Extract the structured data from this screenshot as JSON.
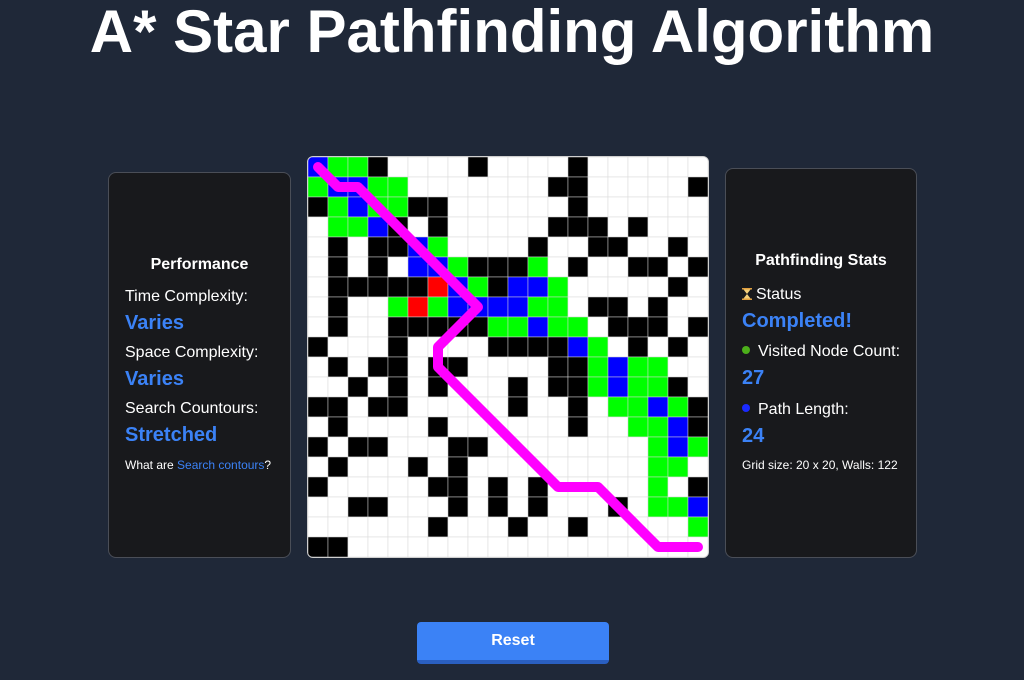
{
  "title": "A* Star Pathfinding Algorithm",
  "performance": {
    "heading": "Performance",
    "time_label": "Time Complexity:",
    "time_value": "Varies",
    "space_label": "Space Complexity:",
    "space_value": "Varies",
    "contour_label": "Search Countours:",
    "contour_value": "Stretched",
    "question_prefix": "What are ",
    "question_link": "Search contours",
    "question_suffix": "?"
  },
  "stats": {
    "heading": "Pathfinding Stats",
    "status_icon": "hourglass-icon",
    "status_label": "Status",
    "status_value": "Completed!",
    "visited_label": "Visited Node Count:",
    "visited_value": "27",
    "path_label": "Path Length:",
    "path_value": "24",
    "grid_info": "Grid size: 20 x 20, Walls: 122"
  },
  "reset_label": "Reset",
  "colors": {
    "wall": "#000000",
    "empty": "#ffffff",
    "visited": "#00ff00",
    "path_cell": "#0000ff",
    "frontier": "#ff0000",
    "path_line": "#ff00ff",
    "accent": "#3b82f6"
  },
  "grid": {
    "rows": [
      "SVV#....#....#.....",
      "VPPVV.......##.....###",
      "#VPVV##......#.....",
      ".VVP#.#.....###.#...",
      ".#.##PV....#..##..#.",
      ".#.#.PPV###V.#..##.#",
      ".#####RPV#PPV.....#.",
      ".#..VRVPPPPVV.##.#..",
      ".#..#####VVPVV.###.#",
      "#...#....####PV.#.#.",
      ".#.##.##....##VPVV...",
      "..#.#.#...#.##VPVV#.",
      "##.##.....#..#.VVPV#.",
      ".#....#......#..VVP##",
      "#.##...##........VPV#",
      ".#...#.#.........VV.#V",
      "#.....##.#.#.....V.##",
      "..##...#.#.#...#.VVP",
      "......#...#..#.....VP",
      "##..................#VE"
    ]
  }
}
